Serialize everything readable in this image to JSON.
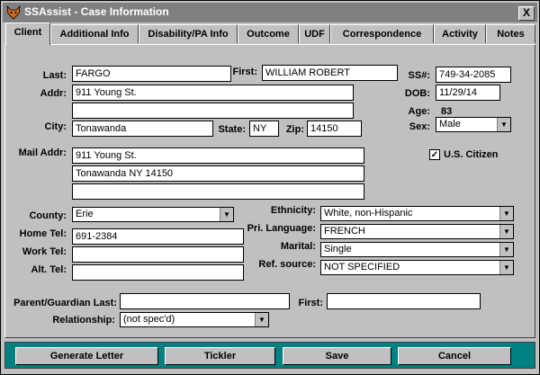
{
  "window": {
    "title": "SSAssist - Case Information",
    "close_label": "X"
  },
  "tabs": [
    "Client",
    "Additional Info",
    "Disability/PA Info",
    "Outcome",
    "UDF",
    "Correspondence",
    "Activity",
    "Notes"
  ],
  "client": {
    "last_label": "Last:",
    "last": "FARGO",
    "first_label": "First:",
    "first": "WILLIAM ROBERT",
    "ssn_label": "SS#:",
    "ssn": "749-34-2085",
    "addr_label": "Addr:",
    "addr1": "911 Young St.",
    "addr2": "",
    "dob_label": "DOB:",
    "dob": "11/29/14",
    "age_label": "Age:",
    "age": "83",
    "city_label": "City:",
    "city": "Tonawanda",
    "state_label": "State:",
    "state": "NY",
    "zip_label": "Zip:",
    "zip": "14150",
    "sex_label": "Sex:",
    "sex": "Male",
    "mail_label": "Mail Addr:",
    "mail1": "911 Young St.",
    "mail2": "Tonawanda NY 14150",
    "mail3": "",
    "citizen_label": "U.S. Citizen",
    "citizen_checked": true,
    "county_label": "County:",
    "county": "Erie",
    "home_tel_label": "Home Tel:",
    "home_tel": "691-2384",
    "work_tel_label": "Work Tel:",
    "work_tel": "",
    "alt_tel_label": "Alt. Tel:",
    "alt_tel": "",
    "ethnicity_label": "Ethnicity:",
    "ethnicity": "White, non-Hispanic",
    "language_label": "Pri. Language:",
    "language": "FRENCH",
    "marital_label": "Marital:",
    "marital": "Single",
    "ref_label": "Ref. source:",
    "ref": "NOT SPECIFIED",
    "guardian_last_label": "Parent/Guardian Last:",
    "guardian_last": "",
    "guardian_first_label": "First:",
    "guardian_first": "",
    "relationship_label": "Relationship:",
    "relationship": "(not spec'd)"
  },
  "buttons": {
    "generate": "Generate Letter",
    "tickler": "Tickler",
    "save": "Save",
    "cancel": "Cancel"
  }
}
